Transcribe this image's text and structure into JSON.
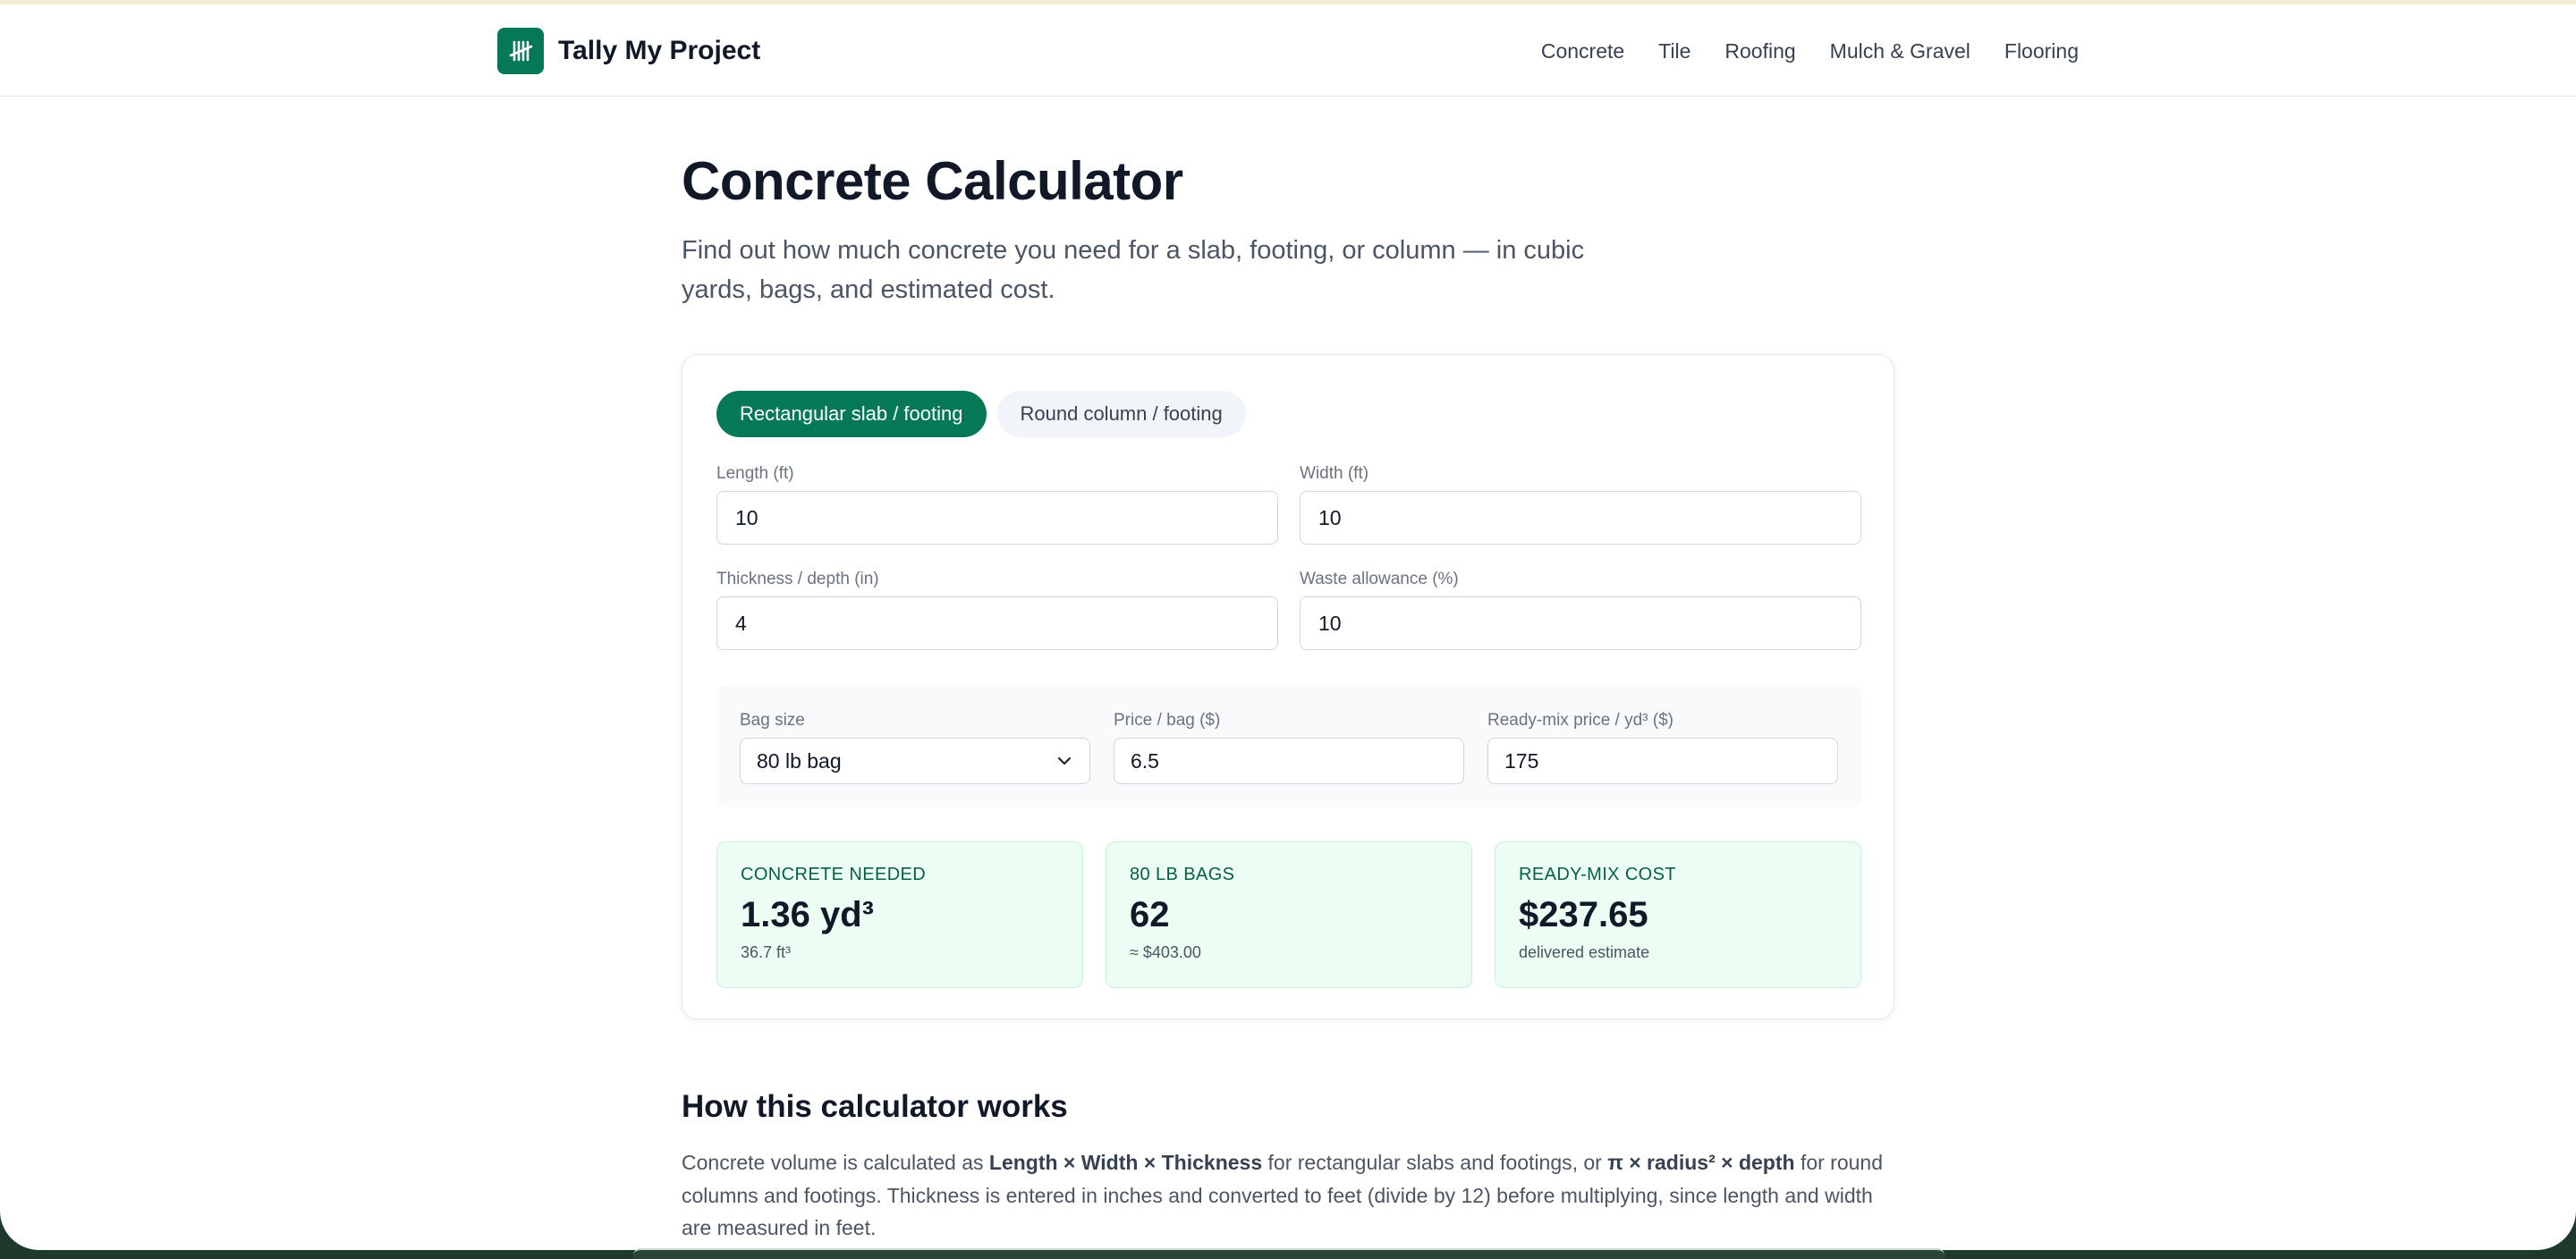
{
  "header": {
    "brand_name": "Tally My Project",
    "nav": [
      "Concrete",
      "Tile",
      "Roofing",
      "Mulch & Gravel",
      "Flooring"
    ]
  },
  "page": {
    "title": "Concrete Calculator",
    "intro": "Find out how much concrete you need for a slab, footing, or column — in cubic yards, bags, and estimated cost."
  },
  "calculator": {
    "tabs": [
      {
        "label": "Rectangular slab / footing",
        "active": true
      },
      {
        "label": "Round column / footing",
        "active": false
      }
    ],
    "fields": {
      "length": {
        "label": "Length (ft)",
        "value": "10"
      },
      "width": {
        "label": "Width (ft)",
        "value": "10"
      },
      "thickness": {
        "label": "Thickness / depth (in)",
        "value": "4"
      },
      "waste": {
        "label": "Waste allowance (%)",
        "value": "10"
      }
    },
    "pricing": {
      "bag_size": {
        "label": "Bag size",
        "value": "80 lb bag"
      },
      "price_per_bag": {
        "label": "Price / bag ($)",
        "value": "6.5"
      },
      "readymix_price": {
        "label": "Ready-mix price / yd³ ($)",
        "value": "175"
      }
    },
    "results": [
      {
        "label": "CONCRETE NEEDED",
        "value": "1.36 yd³",
        "sub": "36.7 ft³"
      },
      {
        "label": "80 LB BAGS",
        "value": "62",
        "sub": "≈ $403.00"
      },
      {
        "label": "READY-MIX COST",
        "value": "$237.65",
        "sub": "delivered estimate"
      }
    ]
  },
  "how": {
    "title": "How this calculator works",
    "text_1": "Concrete volume is calculated as ",
    "formula_1": "Length × Width × Thickness",
    "text_2": " for rectangular slabs and footings, or ",
    "formula_2": "π × radius² × depth",
    "text_3": " for round columns and footings. Thickness is entered in inches and converted to feet (divide by 12) before multiplying, since length and width are measured in feet."
  },
  "colors": {
    "accent": "#047857",
    "result_bg": "#ecfdf3"
  },
  "icons": {
    "logo": "tally-marks-icon",
    "select_arrow": "chevron-down-icon"
  }
}
